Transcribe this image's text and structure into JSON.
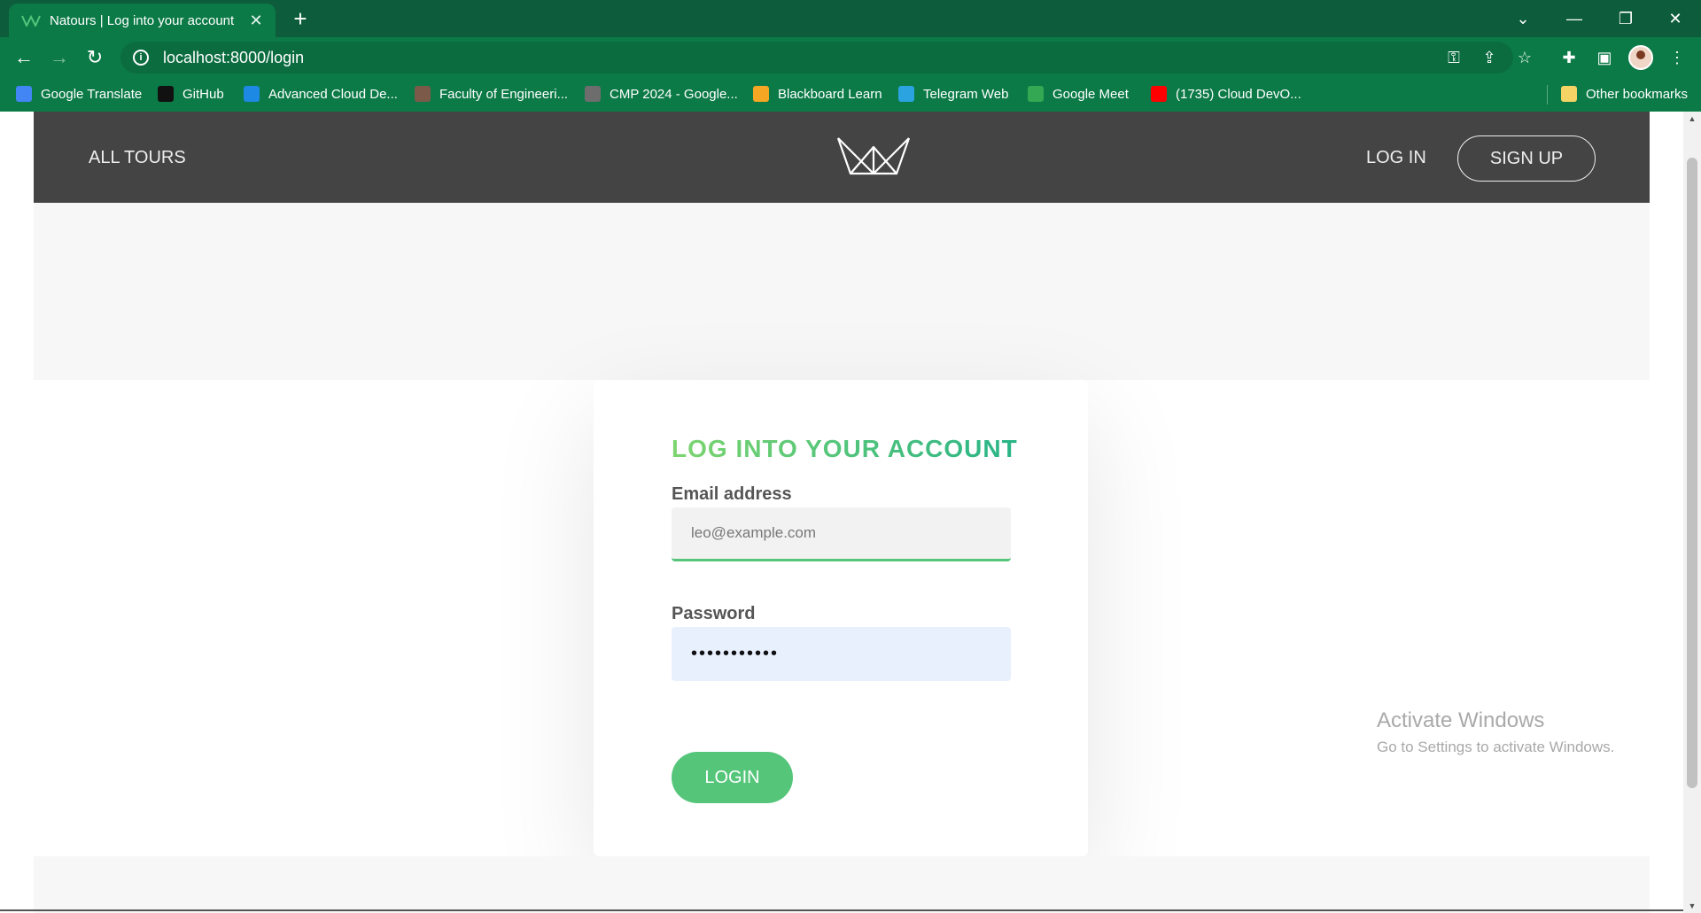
{
  "browser": {
    "tab_title": "Natours | Log into your account",
    "url": "localhost:8000/login",
    "bookmarks": [
      {
        "label": "Google Translate",
        "color": "#4285f4"
      },
      {
        "label": "GitHub",
        "color": "#111111"
      },
      {
        "label": "Advanced Cloud De...",
        "color": "#1e88e5"
      },
      {
        "label": "Faculty of Engineeri...",
        "color": "#7c5a4a"
      },
      {
        "label": "CMP 2024 - Google...",
        "color": "#6d6d6d"
      },
      {
        "label": "Blackboard Learn",
        "color": "#f5a623"
      },
      {
        "label": "Telegram Web",
        "color": "#2aa3e0"
      },
      {
        "label": "Google Meet",
        "color": "#34a853"
      },
      {
        "label": "(1735) Cloud DevO...",
        "color": "#ff0000"
      }
    ],
    "other_bookmarks": "Other bookmarks"
  },
  "header": {
    "all_tours": "All tours",
    "log_in": "Log in",
    "sign_up": "Sign up"
  },
  "login": {
    "title": "Log into your account",
    "email_label": "Email address",
    "email_value": "leo@example.com",
    "password_label": "Password",
    "password_value": "•••••••••••",
    "button": "Login"
  },
  "watermark": {
    "title": "Activate Windows",
    "subtitle": "Go to Settings to activate Windows."
  },
  "colors": {
    "brand_green": "#55c57a",
    "header_bg": "#444444",
    "chrome_green": "#0b7a47"
  }
}
